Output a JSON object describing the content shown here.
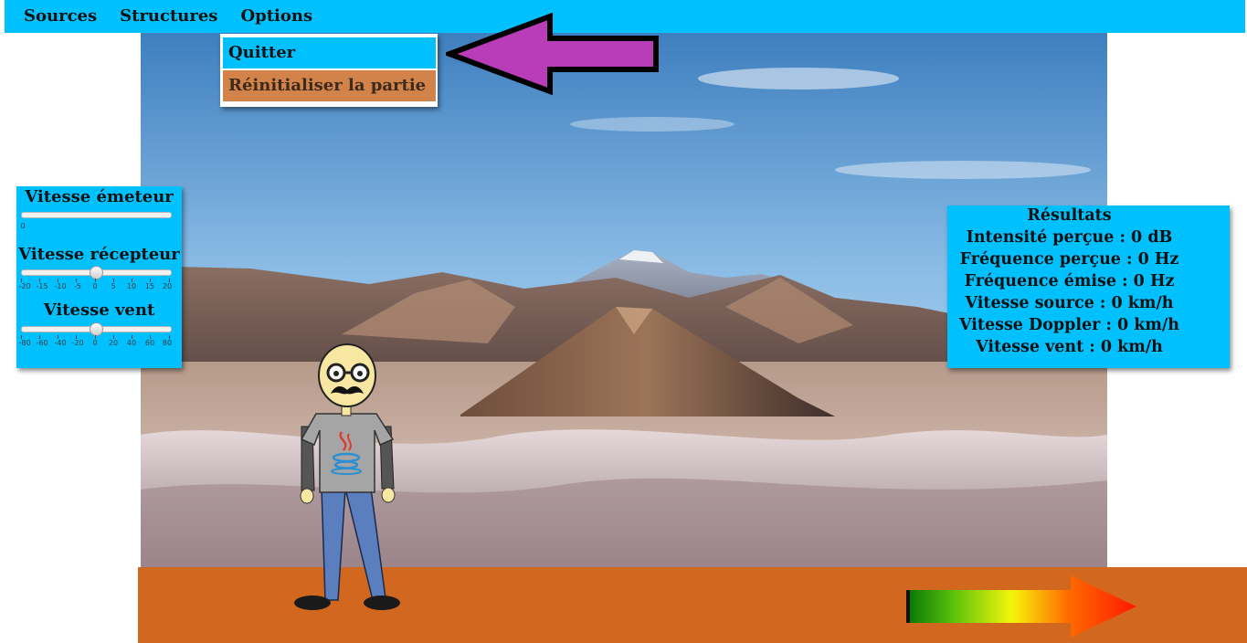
{
  "menu": {
    "items": [
      "Sources",
      "Structures",
      "Options"
    ]
  },
  "options_menu": {
    "quit_label": "Quitter",
    "reset_label": "Réinitialiser la partie"
  },
  "controls": {
    "emitter_speed": {
      "label": "Vitesse émeteur",
      "ticks": [
        "0"
      ],
      "value": 0
    },
    "receiver_speed": {
      "label": "Vitesse récepteur",
      "ticks": [
        "-20",
        "-15",
        "-10",
        "-5",
        "0",
        "5",
        "10",
        "15",
        "20"
      ],
      "value": 0
    },
    "wind_speed": {
      "label": "Vitesse vent",
      "ticks": [
        "-80",
        "-60",
        "-40",
        "-20",
        "0",
        "20",
        "40",
        "60",
        "80"
      ],
      "value": 0
    }
  },
  "results": {
    "title": "Résultats",
    "perceived_intensity": "Intensité perçue : 0 dB",
    "perceived_frequency": "Fréquence perçue : 0 Hz",
    "emitted_frequency": "Fréquence émise : 0 Hz",
    "source_speed": "Vitesse source : 0 km/h",
    "doppler_speed": "Vitesse Doppler : 0 km/h",
    "wind_speed": "Vitesse vent : 0 km/h"
  },
  "colors": {
    "panel_bg": "#01c0fe",
    "ground": "#d2681f",
    "pointer_arrow": "#b93db9",
    "direction_arrow": "#ff1a00"
  },
  "icons": {
    "pointer": "left-arrow-icon",
    "direction": "gradient-right-arrow-icon",
    "character": "java-character"
  }
}
